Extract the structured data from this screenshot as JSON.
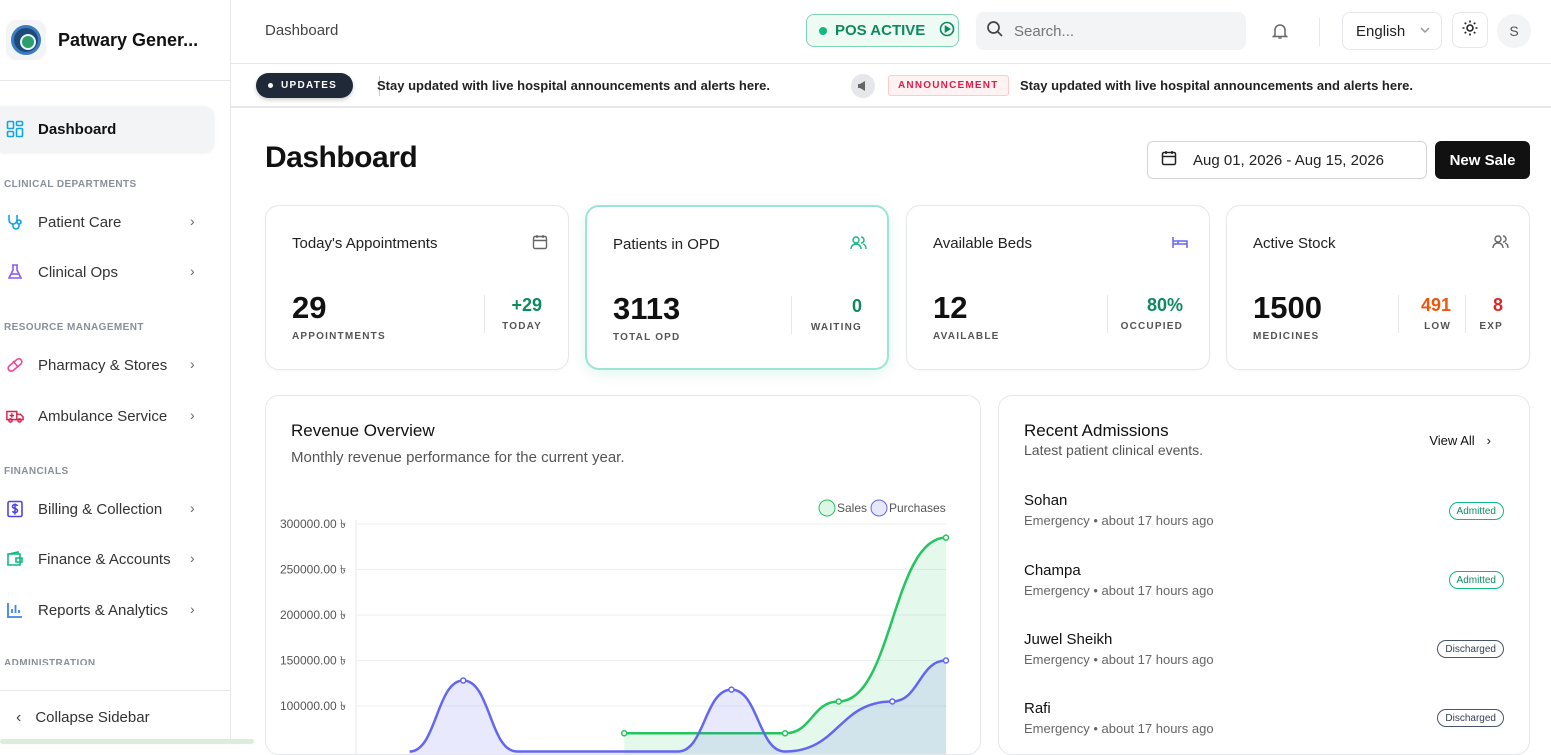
{
  "brand": {
    "name": "Patwary Gener..."
  },
  "sidebar": {
    "items": [
      {
        "label": "Dashboard",
        "icon": "grid-icon"
      },
      {
        "section": "CLINICAL DEPARTMENTS"
      },
      {
        "label": "Patient Care",
        "icon": "stethoscope-icon"
      },
      {
        "label": "Clinical Ops",
        "icon": "flask-icon"
      },
      {
        "section": "RESOURCE MANAGEMENT"
      },
      {
        "label": "Pharmacy & Stores",
        "icon": "pill-icon"
      },
      {
        "label": "Ambulance Service",
        "icon": "ambulance-icon"
      },
      {
        "section": "FINANCIALS"
      },
      {
        "label": "Billing & Collection",
        "icon": "dollar-icon"
      },
      {
        "label": "Finance & Accounts",
        "icon": "wallet-icon"
      },
      {
        "label": "Reports & Analytics",
        "icon": "bar-chart-icon"
      },
      {
        "section": "ADMINISTRATION"
      }
    ],
    "collapse_label": "Collapse Sidebar"
  },
  "topbar": {
    "breadcrumb": "Dashboard",
    "pos_label": "POS ACTIVE",
    "search_placeholder": "Search...",
    "language": "English",
    "avatar_initial": "S"
  },
  "ticker": {
    "updates_label": "UPDATES",
    "message_1": "Stay updated with live hospital announcements and alerts here.",
    "announcement_label": "ANNOUNCEMENT",
    "message_2": "Stay updated with live hospital announcements and alerts here."
  },
  "main": {
    "title": "Dashboard",
    "date_range": "Aug 01, 2026 - Aug 15, 2026",
    "new_sale_label": "New Sale"
  },
  "cards": [
    {
      "title": "Today's Appointments",
      "value": "29",
      "label": "APPOINTMENTS",
      "stats": [
        {
          "value": "+29",
          "label": "TODAY",
          "color": "#0f8a5f"
        }
      ]
    },
    {
      "title": "Patients in OPD",
      "value": "3113",
      "label": "TOTAL OPD",
      "stats": [
        {
          "value": "0",
          "label": "WAITING",
          "color": "#0f8a5f"
        }
      ]
    },
    {
      "title": "Available Beds",
      "value": "12",
      "label": "AVAILABLE",
      "stats": [
        {
          "value": "80%",
          "label": "OCCUPIED",
          "color": "#0f8a5f"
        }
      ]
    },
    {
      "title": "Active Stock",
      "value": "1500",
      "label": "MEDICINES",
      "stats": [
        {
          "value": "491",
          "label": "LOW",
          "color": "#ea580c"
        },
        {
          "value": "8",
          "label": "EXP",
          "color": "#dc2626"
        }
      ]
    }
  ],
  "revenue": {
    "title": "Revenue Overview",
    "subtitle": "Monthly revenue performance for the current year."
  },
  "chart_data": {
    "type": "area",
    "legend": [
      "Sales",
      "Purchases"
    ],
    "legend_position": "top-right",
    "y_ticks": [
      "300000.00 ৳",
      "250000.00 ৳",
      "200000.00 ৳",
      "150000.00 ৳",
      "100000.00 ৳"
    ],
    "ylim": [
      100000,
      300000
    ],
    "grid": true,
    "series": [
      {
        "name": "Sales",
        "color": "#22c55e",
        "x": [
          6,
          9,
          10,
          12
        ],
        "y": [
          70000,
          70000,
          105000,
          285000
        ]
      },
      {
        "name": "Purchases",
        "color": "#6366f1",
        "x": [
          2,
          3,
          4,
          7,
          8,
          9,
          11,
          12
        ],
        "y": [
          50000,
          128000,
          50000,
          50000,
          118000,
          50000,
          105000,
          150000
        ]
      }
    ]
  },
  "admissions": {
    "title": "Recent Admissions",
    "subtitle": "Latest patient clinical events.",
    "view_all": "View All",
    "rows": [
      {
        "name": "Sohan",
        "meta": "Emergency • about 17 hours ago",
        "status": "Admitted"
      },
      {
        "name": "Champa",
        "meta": "Emergency • about 17 hours ago",
        "status": "Admitted"
      },
      {
        "name": "Juwel Sheikh",
        "meta": "Emergency • about 17 hours ago",
        "status": "Discharged"
      },
      {
        "name": "Rafi",
        "meta": "Emergency • about 17 hours ago",
        "status": "Discharged"
      }
    ]
  }
}
